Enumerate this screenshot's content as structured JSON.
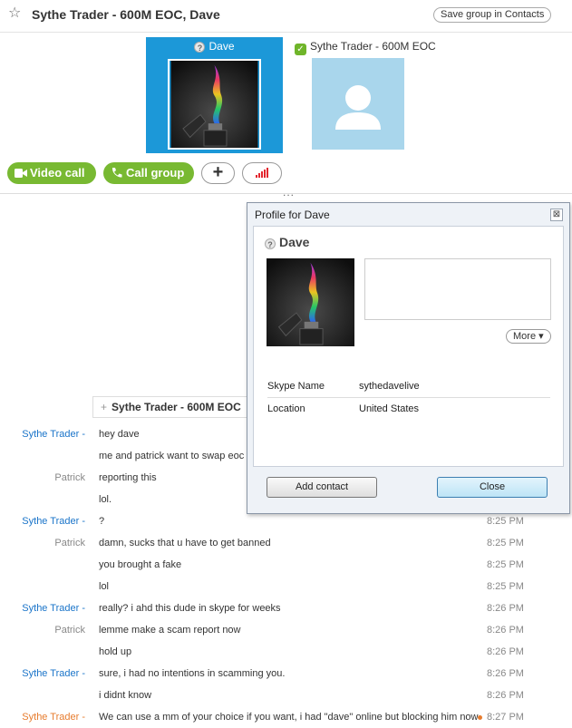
{
  "header": {
    "title": "Sythe Trader - 600M EOC, Dave",
    "save_group_label": "Save group in Contacts"
  },
  "participants": [
    {
      "name": "Dave",
      "status": "unknown"
    },
    {
      "name": "Sythe Trader - 600M EOC",
      "status": "contact"
    }
  ],
  "actions": {
    "video_call": "Video call",
    "call_group": "Call group"
  },
  "overflow_dots": "...",
  "chat": {
    "group_label": "Sythe Trader - 600M EOC",
    "messages": [
      {
        "sender": "Sythe Trader -",
        "text": "hey dave",
        "time": ""
      },
      {
        "sender": "",
        "text": "me and patrick want to swap eoc",
        "time": ""
      },
      {
        "sender": "Patrick",
        "text": "reporting this",
        "time": ""
      },
      {
        "sender": "",
        "text": "lol.",
        "time": ""
      },
      {
        "sender": "Sythe Trader -",
        "text": "?",
        "time": "8:25 PM"
      },
      {
        "sender": "Patrick",
        "text": "damn, sucks that u have to get banned",
        "time": "8:25 PM"
      },
      {
        "sender": "",
        "text": "you brought a fake",
        "time": "8:25 PM"
      },
      {
        "sender": "",
        "text": "lol",
        "time": "8:25 PM"
      },
      {
        "sender": "Sythe Trader -",
        "text": "really? i ahd this dude in skype for weeks",
        "time": "8:26 PM"
      },
      {
        "sender": "Patrick",
        "text": "lemme make a scam report now",
        "time": "8:26 PM"
      },
      {
        "sender": "",
        "text": "hold up",
        "time": "8:26 PM"
      },
      {
        "sender": "Sythe Trader -",
        "text": "sure, i had no intentions in scamming you.",
        "time": "8:26 PM"
      },
      {
        "sender": "",
        "text": "i didnt know",
        "time": "8:26 PM"
      },
      {
        "sender": "Sythe Trader -",
        "text": "We can use a mm of your choice if you want, i had \"dave\" online but blocking him now",
        "time": "8:27 PM"
      }
    ]
  },
  "profile_dialog": {
    "title": "Profile for Dave",
    "close_x": "⊠",
    "name": "Dave",
    "more_label": "More ▾",
    "fields": [
      {
        "label": "Skype Name",
        "value": "sythedavelive"
      },
      {
        "label": "Location",
        "value": "United States"
      }
    ],
    "add_contact_label": "Add contact",
    "close_label": "Close"
  },
  "colors": {
    "accent_blue": "#1c98d8",
    "green_button": "#78b932",
    "sender_blue": "#1a74c9",
    "sender_orange": "#e77c2e",
    "placeholder_avatar": "#a9d6ec"
  }
}
